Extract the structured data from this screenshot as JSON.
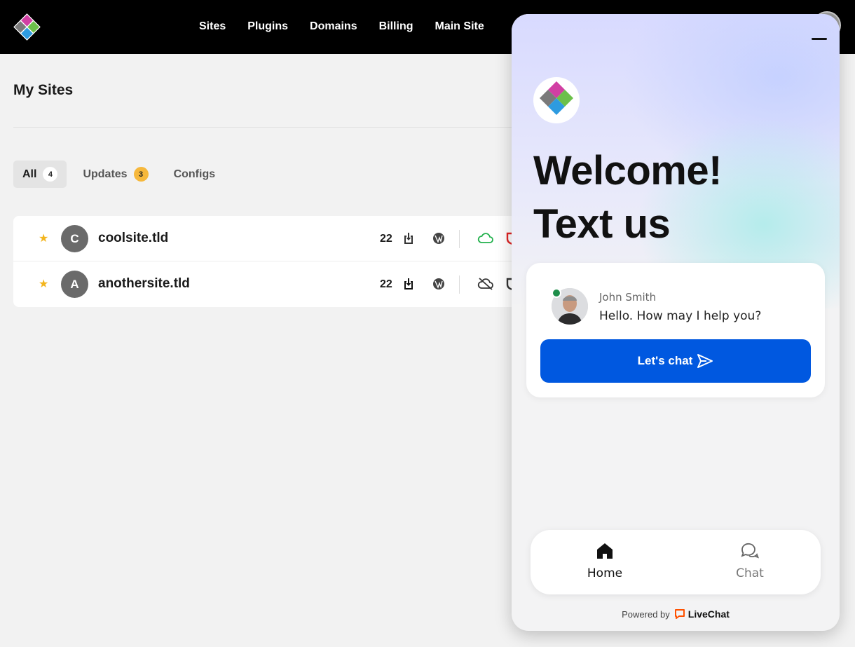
{
  "nav": {
    "items": [
      {
        "label": "Sites"
      },
      {
        "label": "Plugins"
      },
      {
        "label": "Domains"
      },
      {
        "label": "Billing"
      },
      {
        "label": "Main Site"
      }
    ]
  },
  "page": {
    "title": "My Sites"
  },
  "tabs": [
    {
      "label": "All",
      "badge": "4"
    },
    {
      "label": "Updates",
      "badge": "3"
    },
    {
      "label": "Configs"
    }
  ],
  "sites": [
    {
      "initial": "C",
      "name": "coolsite.tld",
      "count": "22",
      "cloud": "connected"
    },
    {
      "initial": "A",
      "name": "anothersite.tld",
      "count": "22",
      "cloud": "disconnected"
    }
  ],
  "chat": {
    "welcome_line1": "Welcome!",
    "welcome_line2": "Text us",
    "agent_name": "John Smith",
    "agent_message": "Hello. How may I help you?",
    "cta_label": "Let's chat",
    "bottom_nav": [
      {
        "label": "Home",
        "icon": "home-icon",
        "active": true
      },
      {
        "label": "Chat",
        "icon": "chat-bubbles-icon",
        "active": false
      }
    ],
    "powered_prefix": "Powered by",
    "powered_brand": "LiveChat"
  },
  "colors": {
    "topbar": "#000000",
    "cta": "#0058e0",
    "star": "#f3b51d",
    "updates_badge": "#f6b83c",
    "online": "#1e8e4a",
    "cloud_ok": "#22b14c",
    "livechat_brand": "#ff5100"
  }
}
